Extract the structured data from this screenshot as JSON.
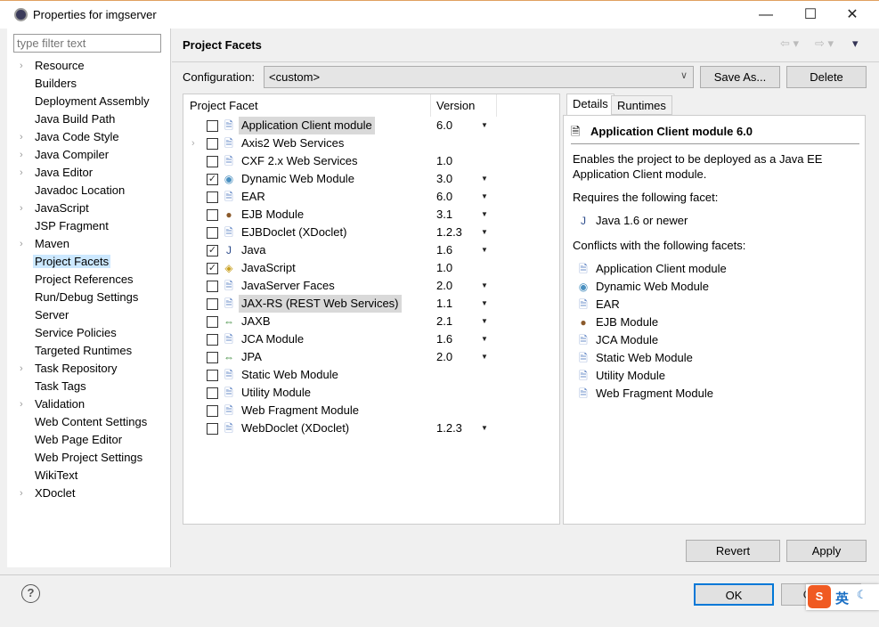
{
  "window": {
    "title": "Properties for imgserver",
    "minimize": "—",
    "maximize": "☐",
    "close": "✕"
  },
  "sidebar": {
    "filter_placeholder": "type filter text",
    "items": [
      {
        "label": "Resource",
        "expandable": true
      },
      {
        "label": "Builders"
      },
      {
        "label": "Deployment Assembly"
      },
      {
        "label": "Java Build Path"
      },
      {
        "label": "Java Code Style",
        "expandable": true
      },
      {
        "label": "Java Compiler",
        "expandable": true
      },
      {
        "label": "Java Editor",
        "expandable": true
      },
      {
        "label": "Javadoc Location"
      },
      {
        "label": "JavaScript",
        "expandable": true
      },
      {
        "label": "JSP Fragment"
      },
      {
        "label": "Maven",
        "expandable": true
      },
      {
        "label": "Project Facets",
        "selected": true
      },
      {
        "label": "Project References"
      },
      {
        "label": "Run/Debug Settings"
      },
      {
        "label": "Server"
      },
      {
        "label": "Service Policies"
      },
      {
        "label": "Targeted Runtimes"
      },
      {
        "label": "Task Repository",
        "expandable": true
      },
      {
        "label": "Task Tags"
      },
      {
        "label": "Validation",
        "expandable": true
      },
      {
        "label": "Web Content Settings"
      },
      {
        "label": "Web Page Editor"
      },
      {
        "label": "Web Project Settings"
      },
      {
        "label": "WikiText"
      },
      {
        "label": "XDoclet",
        "expandable": true
      }
    ]
  },
  "header": {
    "title": "Project Facets"
  },
  "configuration": {
    "label": "Configuration:",
    "value": "<custom>",
    "save_as": "Save As...",
    "delete": "Delete"
  },
  "facets": {
    "col_facet": "Project Facet",
    "col_version": "Version",
    "rows": [
      {
        "name": "Application Client module",
        "version": "6.0",
        "checked": false,
        "dropdown": true,
        "icon": "doc",
        "selected": true
      },
      {
        "name": "Axis2 Web Services",
        "version": "",
        "checked": false,
        "icon": "doc",
        "expandable": true
      },
      {
        "name": "CXF 2.x Web Services",
        "version": "1.0",
        "checked": false,
        "icon": "doc"
      },
      {
        "name": "Dynamic Web Module",
        "version": "3.0",
        "checked": true,
        "dropdown": true,
        "icon": "globe"
      },
      {
        "name": "EAR",
        "version": "6.0",
        "checked": false,
        "dropdown": true,
        "icon": "doc"
      },
      {
        "name": "EJB Module",
        "version": "3.1",
        "checked": false,
        "dropdown": true,
        "icon": "bean"
      },
      {
        "name": "EJBDoclet (XDoclet)",
        "version": "1.2.3",
        "checked": false,
        "dropdown": true,
        "icon": "doc"
      },
      {
        "name": "Java",
        "version": "1.6",
        "checked": true,
        "dropdown": true,
        "icon": "java"
      },
      {
        "name": "JavaScript",
        "version": "1.0",
        "checked": true,
        "icon": "js"
      },
      {
        "name": "JavaServer Faces",
        "version": "2.0",
        "checked": false,
        "dropdown": true,
        "icon": "doc"
      },
      {
        "name": "JAX-RS (REST Web Services)",
        "version": "1.1",
        "checked": false,
        "dropdown": true,
        "icon": "doc",
        "selected": true
      },
      {
        "name": "JAXB",
        "version": "2.1",
        "checked": false,
        "dropdown": true,
        "icon": "arrows"
      },
      {
        "name": "JCA Module",
        "version": "1.6",
        "checked": false,
        "dropdown": true,
        "icon": "doc"
      },
      {
        "name": "JPA",
        "version": "2.0",
        "checked": false,
        "dropdown": true,
        "icon": "arrows"
      },
      {
        "name": "Static Web Module",
        "version": "",
        "checked": false,
        "icon": "doc"
      },
      {
        "name": "Utility Module",
        "version": "",
        "checked": false,
        "icon": "doc"
      },
      {
        "name": "Web Fragment Module",
        "version": "",
        "checked": false,
        "icon": "doc"
      },
      {
        "name": "WebDoclet (XDoclet)",
        "version": "1.2.3",
        "checked": false,
        "dropdown": true,
        "icon": "doc"
      }
    ]
  },
  "details": {
    "tab_details": "Details",
    "tab_runtimes": "Runtimes",
    "title": "Application Client module 6.0",
    "description": "Enables the project to be deployed as a Java EE Application Client module.",
    "requires_label": "Requires the following facet:",
    "requires": [
      {
        "name": "Java 1.6 or newer",
        "icon": "java"
      }
    ],
    "conflicts_label": "Conflicts with the following facets:",
    "conflicts": [
      {
        "name": "Application Client module",
        "icon": "doc"
      },
      {
        "name": "Dynamic Web Module",
        "icon": "globe"
      },
      {
        "name": "EAR",
        "icon": "doc"
      },
      {
        "name": "EJB Module",
        "icon": "bean"
      },
      {
        "name": "JCA Module",
        "icon": "doc"
      },
      {
        "name": "Static Web Module",
        "icon": "doc"
      },
      {
        "name": "Utility Module",
        "icon": "doc"
      },
      {
        "name": "Web Fragment Module",
        "icon": "doc"
      }
    ]
  },
  "buttons": {
    "revert": "Revert",
    "apply": "Apply",
    "ok": "OK",
    "cancel": "Cancel",
    "help": "?"
  },
  "ime": {
    "logo": "S",
    "mode": "英"
  }
}
